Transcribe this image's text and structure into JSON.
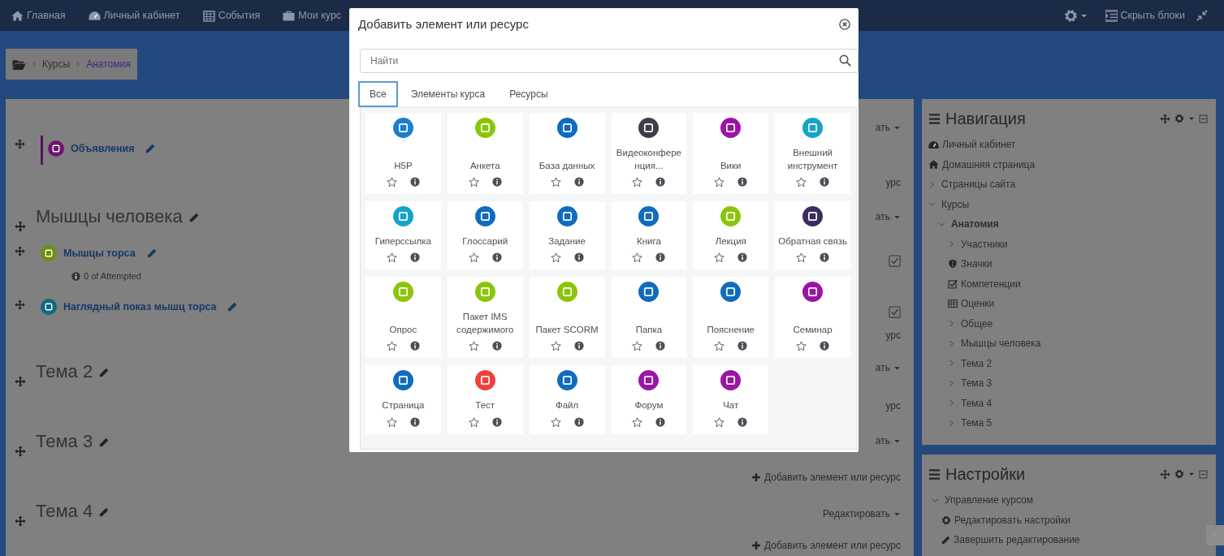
{
  "navbar": {
    "items": [
      {
        "label": "Главная"
      },
      {
        "label": "Личный кабинет"
      },
      {
        "label": "События"
      },
      {
        "label": "Мои курс"
      }
    ],
    "hide_blocks": "Скрыть блоки"
  },
  "breadcrumb": [
    {
      "label": "Курсы",
      "current": false
    },
    {
      "label": "Анатомия",
      "current": true
    }
  ],
  "course": {
    "sections": [
      {
        "activities": [
          {
            "name": "Объявления",
            "color": "#6e1470"
          }
        ]
      },
      {
        "title": "Мышцы человека",
        "activities": [
          {
            "name": "Мышцы торса",
            "color": "#6f8f12",
            "note": "0 of Attempted"
          },
          {
            "name": "Наглядный показ мышц торса",
            "color": "#0e6a80"
          }
        ]
      },
      {
        "title": "Тема 2"
      },
      {
        "title": "Тема 3"
      },
      {
        "title": "Тема 4"
      }
    ],
    "actions": [
      {
        "kind": "edit",
        "label": "ать"
      },
      {
        "kind": "text",
        "label": "урс"
      },
      {
        "kind": "edit",
        "label": "ать"
      },
      {
        "kind": "completion"
      },
      {
        "kind": "completion"
      },
      {
        "kind": "text",
        "label": "урс"
      },
      {
        "kind": "edit",
        "label": "ать"
      },
      {
        "kind": "text",
        "label": "урс"
      },
      {
        "kind": "edit",
        "label": "ать"
      },
      {
        "kind": "add",
        "label": "Добавить элемент или ресурс"
      },
      {
        "kind": "edit",
        "label": "Редактировать"
      },
      {
        "kind": "add",
        "label": "Добавить элемент или ресурс"
      }
    ]
  },
  "navigation": {
    "title": "Навигация",
    "items": [
      {
        "label": "Личный кабинет",
        "kind": "dashboard"
      },
      {
        "label": "Домашняя страница",
        "kind": "home"
      },
      {
        "label": "Страницы сайта",
        "kind": "branch",
        "expanded": false
      },
      {
        "label": "Курсы",
        "kind": "branch",
        "expanded": true,
        "children": [
          {
            "label": "Анатомия",
            "kind": "branch",
            "expanded": true,
            "current": true,
            "children": [
              {
                "label": "Участники",
                "kind": "branch",
                "expanded": false
              },
              {
                "label": "Значки",
                "kind": "shield"
              },
              {
                "label": "Компетенции",
                "kind": "check"
              },
              {
                "label": "Оценки",
                "kind": "table"
              },
              {
                "label": "Общее",
                "kind": "branch",
                "expanded": false
              },
              {
                "label": "Мышцы человека",
                "kind": "branch",
                "expanded": false
              },
              {
                "label": "Тема 2",
                "kind": "branch",
                "expanded": false
              },
              {
                "label": "Тема 3",
                "kind": "branch",
                "expanded": false
              },
              {
                "label": "Тема 4",
                "kind": "branch",
                "expanded": false
              },
              {
                "label": "Тема 5",
                "kind": "branch",
                "expanded": false
              }
            ]
          }
        ]
      }
    ]
  },
  "settings": {
    "title": "Настройки",
    "items": [
      {
        "label": "Управление курсом",
        "kind": "branch",
        "expanded": true,
        "children": [
          {
            "label": "Редактировать настройки",
            "kind": "gear"
          },
          {
            "label": "Завершить редактирование",
            "kind": "pencil"
          }
        ]
      }
    ]
  },
  "modal": {
    "title": "Добавить элемент или ресурс",
    "search": {
      "placeholder": "Найти"
    },
    "tabs": [
      {
        "label": "Все",
        "selected": true
      },
      {
        "label": "Элементы курса",
        "selected": false
      },
      {
        "label": "Ресурсы",
        "selected": false
      }
    ],
    "items": [
      {
        "name": "H5P",
        "color": "#1b7fd0",
        "starred": false
      },
      {
        "name": "Анкета",
        "color": "#8cc40a",
        "starred": false
      },
      {
        "name": "База данных",
        "color": "#0f6cbf",
        "starred": false
      },
      {
        "name": "Видеоконференция...",
        "color": "#3c3f45",
        "starred": false
      },
      {
        "name": "Вики",
        "color": "#9b14a6",
        "starred": false
      },
      {
        "name": "Внешний инструмент",
        "color": "#14a3c9",
        "starred": false
      },
      {
        "name": "Гиперссылка",
        "color": "#14a3c9",
        "starred": false
      },
      {
        "name": "Глоссарий",
        "color": "#0f6cbf",
        "starred": false
      },
      {
        "name": "Задание",
        "color": "#0f6cbf",
        "starred": false
      },
      {
        "name": "Книга",
        "color": "#0f6cbf",
        "starred": false
      },
      {
        "name": "Лекция",
        "color": "#8cc40a",
        "starred": false
      },
      {
        "name": "Обратная связь",
        "color": "#392c5e",
        "starred": false
      },
      {
        "name": "Опрос",
        "color": "#8cc40a",
        "starred": false
      },
      {
        "name": "Пакет IMS содержимого",
        "color": "#8cc40a",
        "starred": false
      },
      {
        "name": "Пакет SCORM",
        "color": "#8cc40a",
        "starred": false
      },
      {
        "name": "Папка",
        "color": "#0f6cbf",
        "starred": false
      },
      {
        "name": "Пояснение",
        "color": "#0f6cbf",
        "starred": false
      },
      {
        "name": "Семинар",
        "color": "#9b14a6",
        "starred": false
      },
      {
        "name": "Страница",
        "color": "#0f6cbf",
        "starred": false
      },
      {
        "name": "Тест",
        "color": "#f0403c",
        "starred": false
      },
      {
        "name": "Файл",
        "color": "#0f6cbf",
        "starred": false
      },
      {
        "name": "Форум",
        "color": "#9b14a6",
        "starred": false
      },
      {
        "name": "Чат",
        "color": "#9b14a6",
        "starred": false
      }
    ]
  }
}
